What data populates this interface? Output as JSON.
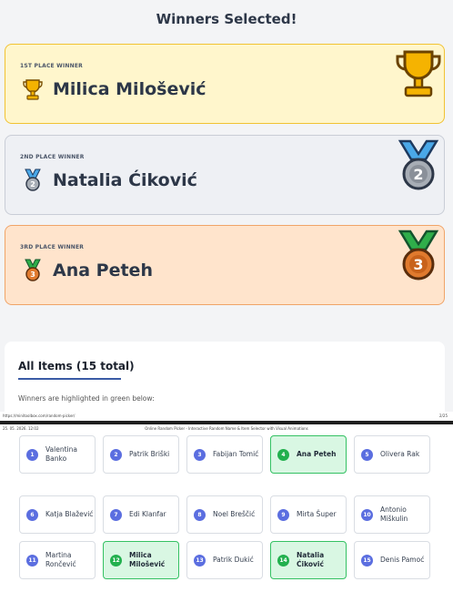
{
  "page1": {
    "heading": "Winners Selected!",
    "winners": [
      {
        "place": "1ST PLACE WINNER",
        "name": "Milica Milošević",
        "icon": "trophy-icon"
      },
      {
        "place": "2ND PLACE WINNER",
        "name": "Natalia Ćiković",
        "icon": "silver-medal-icon"
      },
      {
        "place": "3RD PLACE WINNER",
        "name": "Ana Peteh",
        "icon": "bronze-medal-icon"
      }
    ],
    "items_title": "All Items (15 total)",
    "items_subtitle": "Winners are highlighted in green below:",
    "footer_url": "https://minitoolbox.com/random-picker/",
    "footer_page": "2/25"
  },
  "page2": {
    "header_date": "25. 05. 2026. 12:02",
    "header_title": "Online Random Picker - Interactive Random Name & Item Selector with Visual Animations",
    "items": [
      {
        "num": "1",
        "name": "Valentina Banko",
        "winner": false
      },
      {
        "num": "2",
        "name": "Patrik Briški",
        "winner": false
      },
      {
        "num": "3",
        "name": "Fabijan Tomić",
        "winner": false
      },
      {
        "num": "4",
        "name": "Ana Peteh",
        "winner": true
      },
      {
        "num": "5",
        "name": "Olivera Rak",
        "winner": false
      },
      {
        "num": "6",
        "name": "Katja Blažević",
        "winner": false
      },
      {
        "num": "7",
        "name": "Edi Klanfar",
        "winner": false
      },
      {
        "num": "8",
        "name": "Noel Breščić",
        "winner": false
      },
      {
        "num": "9",
        "name": "Mirta Šuper",
        "winner": false
      },
      {
        "num": "10",
        "name": "Antonio Miškulin",
        "winner": false
      },
      {
        "num": "11",
        "name": "Martina Rončević",
        "winner": false
      },
      {
        "num": "12",
        "name": "Milica Milošević",
        "winner": true
      },
      {
        "num": "13",
        "name": "Patrik Dukić",
        "winner": false
      },
      {
        "num": "14",
        "name": "Natalia Ćiković",
        "winner": true
      },
      {
        "num": "15",
        "name": "Denis Pamoć",
        "winner": false
      }
    ]
  },
  "colors": {
    "gold_bg": "#fff6cc",
    "silver_bg": "#eef0f4",
    "bronze_bg": "#ffe4cc",
    "winner_green": "#22b04e",
    "badge_blue": "#5b6ee0"
  }
}
